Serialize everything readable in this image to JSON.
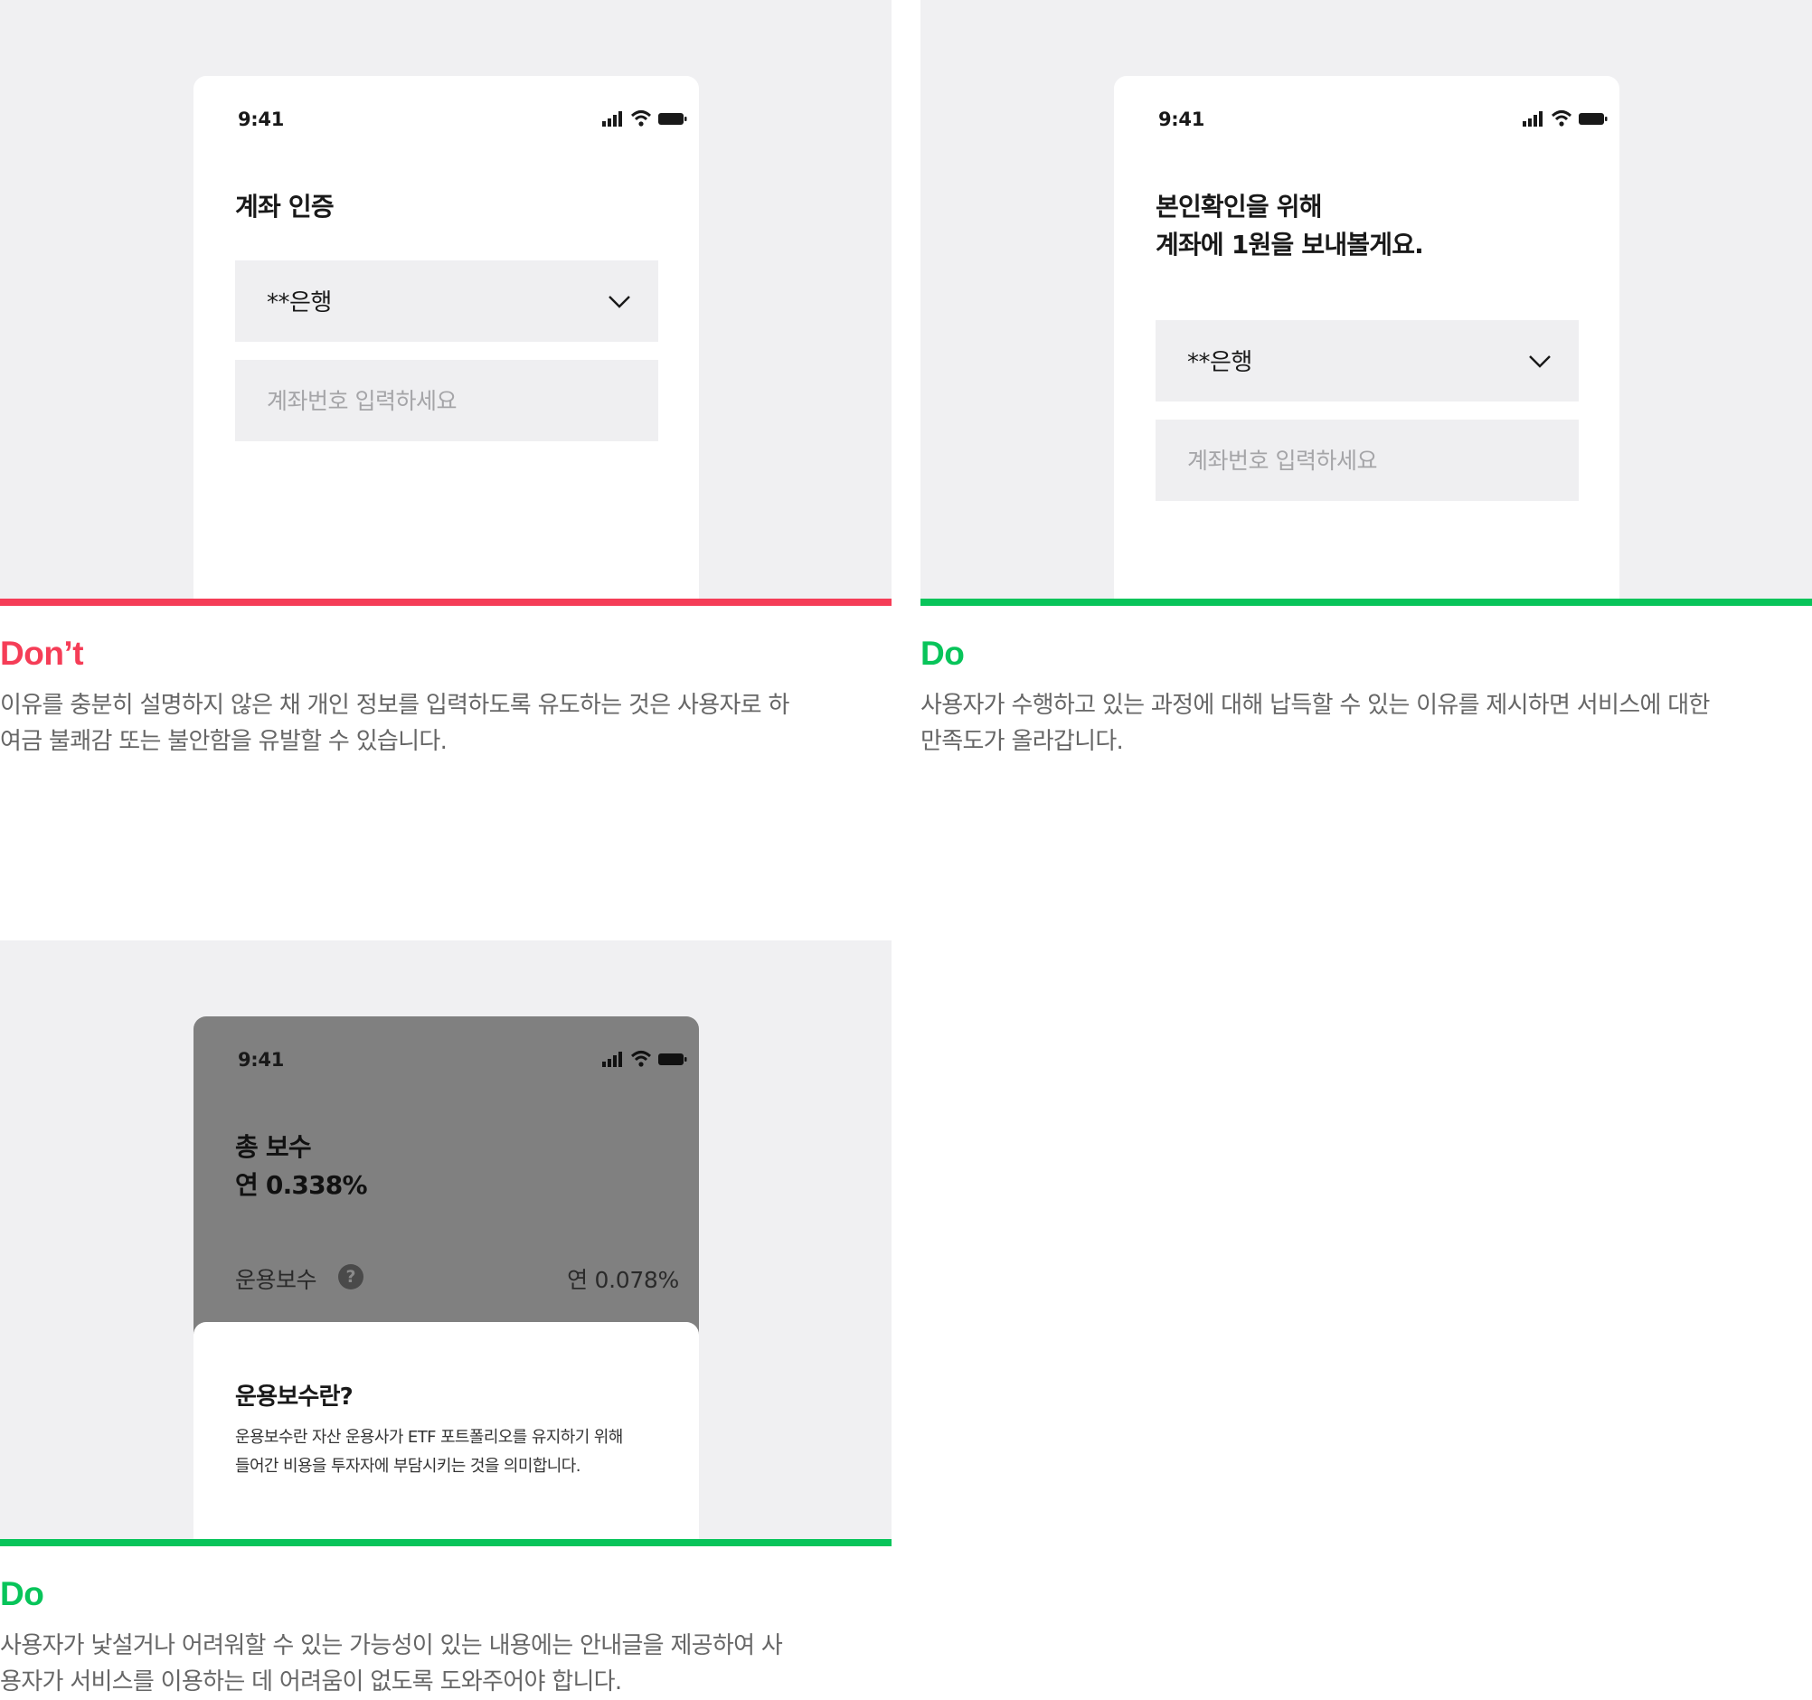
{
  "colors": {
    "dont": "#f53d57",
    "do": "#08c45a",
    "stage_background": "#f0f0f2",
    "field_background": "#efeff1"
  },
  "status_bar": {
    "time": "9:41",
    "icons": [
      "signal-icon",
      "wifi-icon",
      "battery-icon"
    ]
  },
  "examples": [
    {
      "verdict": "Don’t",
      "phone": {
        "title": "계좌 인증",
        "bank_select": "**은행",
        "account_placeholder": "계좌번호 입력하세요"
      },
      "description": "이유를 충분히 설명하지 않은 채 개인 정보를 입력하도록 유도하는 것은 사용자로 하\n여금 불쾌감 또는 불안함을 유발할 수 있습니다."
    },
    {
      "verdict": "Do",
      "phone": {
        "title": "본인확인을 위해\n계좌에 1원을 보내볼게요.",
        "bank_select": "**은행",
        "account_placeholder": "계좌번호 입력하세요"
      },
      "description": "사용자가 수행하고 있는 과정에 대해 납득할 수 있는 이유를 제시하면 서비스에 대한\n만족도가 올라갑니다."
    },
    {
      "verdict": "Do",
      "phone": {
        "title": "총 보수\n연 0.338%",
        "fee_label": "운용보수",
        "help_icon_glyph": "?",
        "fee_value": "연 0.078%",
        "sheet_title": "운용보수란?",
        "sheet_body": "운용보수란 자산 운용사가 ETF 포트폴리오를 유지하기 위해\n들어간 비용을 투자자에 부담시키는 것을 의미합니다."
      },
      "description": "사용자가 낯설거나 어려워할 수 있는 가능성이 있는 내용에는 안내글을 제공하여 사\n용자가 서비스를 이용하는 데 어려움이 없도록 도와주어야 합니다."
    }
  ]
}
